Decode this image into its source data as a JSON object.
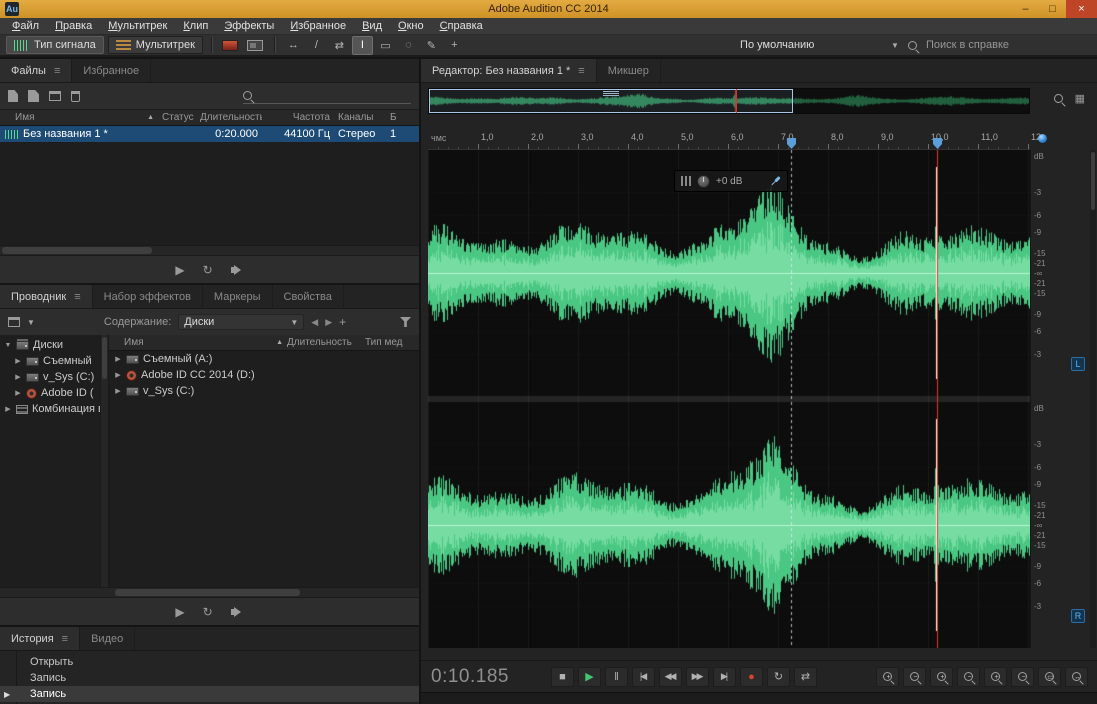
{
  "titlebar": {
    "app_icon_label": "Au",
    "title": "Adobe Audition CC 2014",
    "minimize_glyph": "–",
    "maximize_glyph": "□",
    "close_glyph": "×"
  },
  "menubar": {
    "items": [
      "Файл",
      "Правка",
      "Мультитрек",
      "Клип",
      "Эффекты",
      "Избранное",
      "Вид",
      "Окно",
      "Справка"
    ]
  },
  "toolbar": {
    "view_buttons": [
      {
        "label": "Тип сигнала",
        "active": true
      },
      {
        "label": "Мультитрек",
        "active": false
      }
    ],
    "tools": [
      {
        "name": "move-tool",
        "glyph": "↔",
        "active": false
      },
      {
        "name": "razor-tool",
        "glyph": "/",
        "active": false
      },
      {
        "name": "slip-tool",
        "glyph": "⇄",
        "active": false
      },
      {
        "name": "time-selection-tool",
        "glyph": "I",
        "active": true
      },
      {
        "name": "marquee-selection-tool",
        "glyph": "▭",
        "active": false
      },
      {
        "name": "lasso-selection-tool",
        "glyph": "◌",
        "active": false
      },
      {
        "name": "paintbrush-tool",
        "glyph": "✎",
        "active": false
      },
      {
        "name": "spot-healing-tool",
        "glyph": "+",
        "active": false
      }
    ],
    "workspace_label": "По умолчанию",
    "search_label": "Поиск в справке"
  },
  "icons": {
    "panel_menu": "≡",
    "sort_asc": "▲",
    "expanded": "▼",
    "collapsed": "▶",
    "dropdown": "▼",
    "grid": "▦"
  },
  "files_panel": {
    "tabs": [
      {
        "label": "Файлы",
        "active": true
      },
      {
        "label": "Избранное",
        "active": false
      }
    ],
    "columns": [
      "Имя",
      "Статус",
      "Длительность",
      "Частота",
      "Каналы",
      "Б"
    ],
    "rows": [
      {
        "name": "Без названия 1 *",
        "status": "",
        "duration": "0:20.000",
        "sample_rate": "44100 Гц",
        "channels": "Стерео",
        "bit_depth": "1"
      }
    ]
  },
  "explorer_panel": {
    "tabs": [
      {
        "label": "Проводник",
        "active": true
      },
      {
        "label": "Набор эффектов",
        "active": false
      },
      {
        "label": "Маркеры",
        "active": false
      },
      {
        "label": "Свойства",
        "active": false
      }
    ],
    "content_label": "Содержание:",
    "content_value": "Диски",
    "tree": [
      {
        "label": "Диски",
        "level": 0,
        "expanded": true,
        "icon": "drives"
      },
      {
        "label": "Съемный",
        "level": 1,
        "expanded": false,
        "icon": "drive"
      },
      {
        "label": "v_Sys (C:)",
        "level": 1,
        "expanded": false,
        "icon": "drive"
      },
      {
        "label": "Adobe ID (",
        "level": 1,
        "expanded": false,
        "icon": "disc"
      },
      {
        "label": "Комбинация в",
        "level": 0,
        "expanded": false,
        "icon": "media"
      }
    ],
    "columns": [
      "Имя",
      "Длительность",
      "Тип мед"
    ],
    "rows": [
      {
        "name": "Съемный (A:)",
        "icon": "drive"
      },
      {
        "name": "Adobe ID CC 2014 (D:)",
        "icon": "disc"
      },
      {
        "name": "v_Sys (C:)",
        "icon": "drive"
      }
    ]
  },
  "history_panel": {
    "tabs": [
      {
        "label": "История",
        "active": true
      },
      {
        "label": "Видео",
        "active": false
      }
    ],
    "items": [
      {
        "label": "Открыть",
        "selected": false
      },
      {
        "label": "Запись",
        "selected": false
      },
      {
        "label": "Запись",
        "selected": true
      }
    ]
  },
  "mini_transport": {
    "buttons": [
      {
        "name": "play-button",
        "type": "glyph",
        "glyph": "▶"
      },
      {
        "name": "loop-playback-button",
        "type": "glyph",
        "glyph": "↻"
      },
      {
        "name": "autoplay-button",
        "type": "speaker"
      }
    ]
  },
  "editor": {
    "tabs": [
      {
        "label": "Редактор: Без названия 1 *",
        "active": true
      },
      {
        "label": "Микшер",
        "active": false
      }
    ],
    "hud_gain": "+0 dB",
    "ruler_unit": "чмс",
    "ruler_ticks": [
      "1,0",
      "2,0",
      "3,0",
      "4,0",
      "5,0",
      "6,0",
      "7,0",
      "8,0",
      "9,0",
      "10,0",
      "11,0",
      "12"
    ],
    "amp_scale": {
      "unit": "dB",
      "levels": [
        "-3",
        "-6",
        "-9",
        "-15",
        "-21"
      ],
      "infinity": "-∞"
    },
    "channels": {
      "left": "L",
      "right": "R"
    },
    "waveform_color": "#4fd78c",
    "playhead_color": "#e0382c",
    "playhead_seconds": 10.185,
    "marker_seconds": 7.25,
    "visible_range_seconds": 12.2,
    "total_duration_seconds": 20
  },
  "transport": {
    "time_display": "0:10.185",
    "buttons": [
      {
        "name": "stop-button",
        "glyph": "■"
      },
      {
        "name": "play-button",
        "glyph": "▶",
        "color": "#43c56d"
      },
      {
        "name": "pause-button",
        "glyph": "‖"
      },
      {
        "name": "skip-to-start-button",
        "glyph": "|◀",
        "wide": true
      },
      {
        "name": "rewind-button",
        "glyph": "◀◀",
        "wide": true
      },
      {
        "name": "fast-forward-button",
        "glyph": "▶▶",
        "wide": true
      },
      {
        "name": "skip-to-end-button",
        "glyph": "▶|",
        "wide": true
      },
      {
        "name": "record-button",
        "glyph": "●",
        "color": "#d6432f"
      },
      {
        "name": "loop-playback-button",
        "glyph": "↻"
      },
      {
        "name": "skip-selection-button",
        "glyph": "⇄"
      }
    ],
    "zoom_buttons": [
      {
        "name": "zoom-in-button",
        "sign": "+"
      },
      {
        "name": "zoom-out-button",
        "sign": "−"
      },
      {
        "name": "zoom-in-time-button",
        "sign": "+"
      },
      {
        "name": "zoom-out-time-button",
        "sign": "−"
      },
      {
        "name": "zoom-in-amplitude-button",
        "sign": "+"
      },
      {
        "name": "zoom-out-amplitude-button",
        "sign": "−"
      },
      {
        "name": "zoom-selection-button",
        "sign": "▭"
      },
      {
        "name": "zoom-full-button",
        "sign": "↔"
      }
    ]
  }
}
